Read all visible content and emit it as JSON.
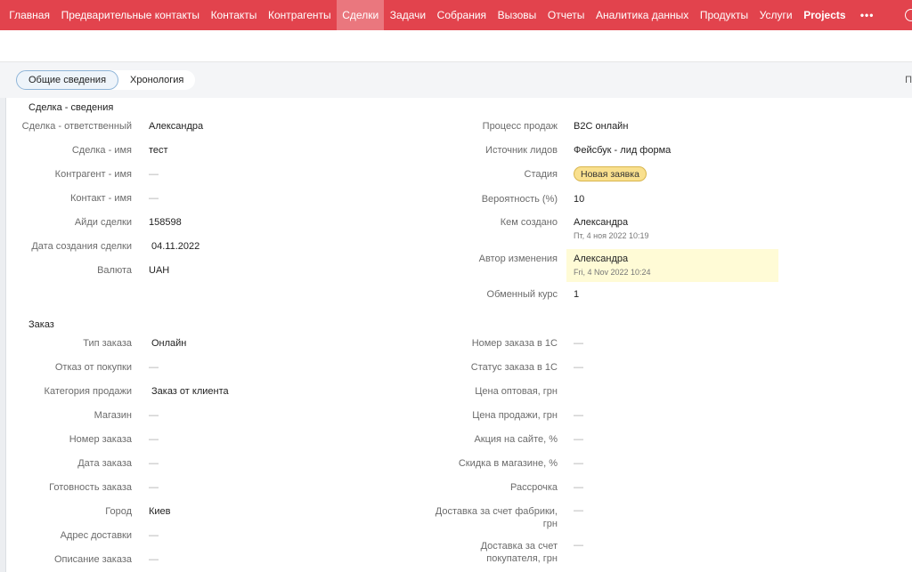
{
  "nav": {
    "items": [
      "Главная",
      "Предварительные контакты",
      "Контакты",
      "Контрагенты",
      "Сделки",
      "Задачи",
      "Собрания",
      "Вызовы",
      "Отчеты",
      "Аналитика данных",
      "Продукты",
      "Услуги",
      "Projects"
    ],
    "active_index": 4,
    "more_label": "•••"
  },
  "tabs": {
    "overview": "Общие сведения",
    "timeline": "Хронология",
    "edge_text": "П"
  },
  "deal_section": {
    "title": "Сделка - сведения",
    "left": [
      {
        "label": "Сделка - ответственный",
        "value": "Александра"
      },
      {
        "label": "Сделка - имя",
        "value": "тест"
      },
      {
        "label": "Контрагент - имя",
        "value": "—"
      },
      {
        "label": "Контакт - имя",
        "value": "—"
      },
      {
        "label": "Айди сделки",
        "value": "158598"
      },
      {
        "label": "Дата создания сделки",
        "value": "04.11.2022"
      },
      {
        "label": "Валюта",
        "value": "UAH"
      }
    ],
    "right": [
      {
        "label": "Процесс продаж",
        "value": "B2C онлайн"
      },
      {
        "label": "Источник лидов",
        "value": "Фейсбук - лид форма"
      },
      {
        "label": "Стадия",
        "value": "Новая заявка"
      },
      {
        "label": "Вероятность (%)",
        "value": "10"
      },
      {
        "label": "Кем создано",
        "value": "Александра",
        "sub": "Пт, 4 ноя 2022 10:19"
      },
      {
        "label": "Автор изменения",
        "value": "Александра",
        "sub": "Fri, 4 Nov 2022 10:24"
      },
      {
        "label": "Обменный курс",
        "value": "1"
      }
    ]
  },
  "order_section": {
    "title": "Заказ",
    "left": [
      {
        "label": "Тип заказа",
        "value": "Онлайн"
      },
      {
        "label": "Отказ от покупки",
        "value": "—"
      },
      {
        "label": "Категория продажи",
        "value": "Заказ от клиента"
      },
      {
        "label": "Магазин",
        "value": "—"
      },
      {
        "label": "Номер заказа",
        "value": "—"
      },
      {
        "label": "Дата заказа",
        "value": "—"
      },
      {
        "label": "Готовность заказа",
        "value": "—"
      },
      {
        "label": "Город",
        "value": "Киев"
      },
      {
        "label": "Адрес доставки",
        "value": "—"
      },
      {
        "label": "Описание заказа",
        "value": "—"
      }
    ],
    "right": [
      {
        "label": "Номер заказа в 1С",
        "value": "—"
      },
      {
        "label": "Статус заказа в 1С",
        "value": "—"
      },
      {
        "label": "Цена оптовая, грн",
        "value": ""
      },
      {
        "label": "Цена продажи, грн",
        "value": "—"
      },
      {
        "label": "Акция на сайте, %",
        "value": "—"
      },
      {
        "label": "Скидка в магазине, %",
        "value": "—"
      },
      {
        "label": "Рассрочка",
        "value": "—"
      },
      {
        "label": "Доставка за счет фабрики, грн",
        "value": "—"
      },
      {
        "label": "Доставка за счет покупателя, грн",
        "value": "—"
      }
    ]
  }
}
